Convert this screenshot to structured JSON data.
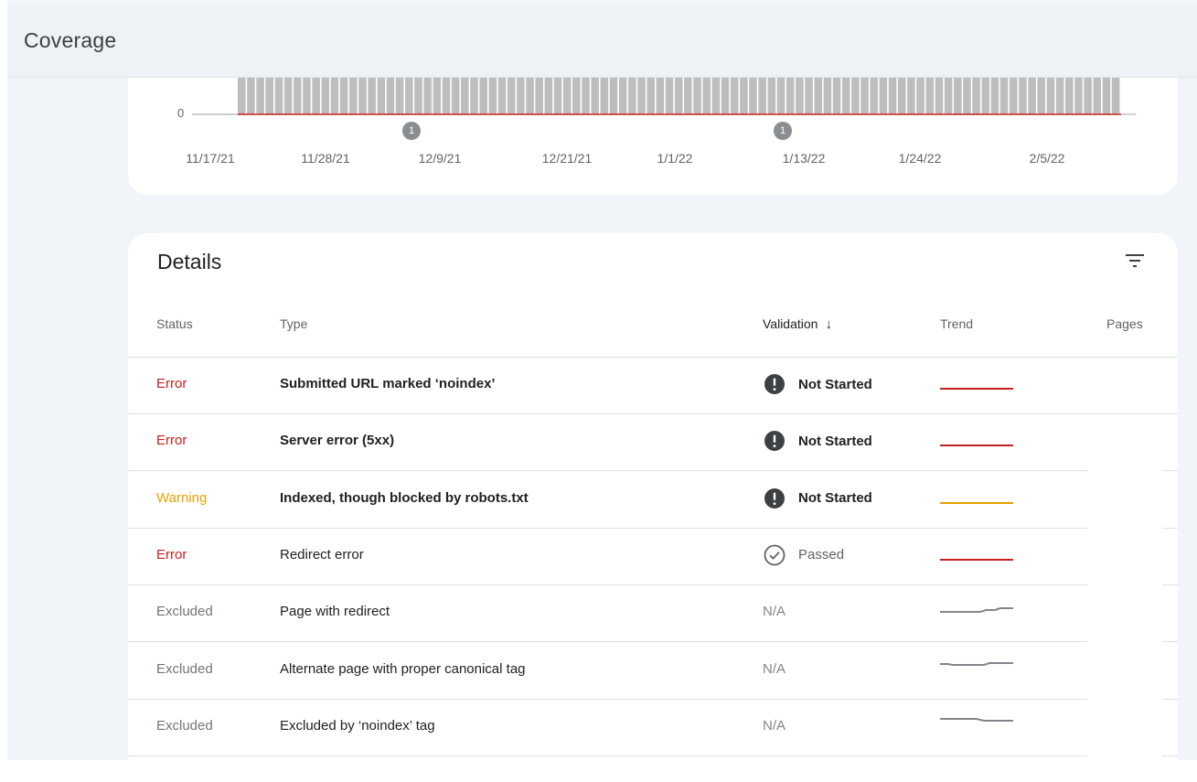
{
  "page": {
    "title": "Coverage"
  },
  "chart_data": {
    "type": "bar",
    "y_tick_labels": [
      "0"
    ],
    "x_tick_labels": [
      "11/17/21",
      "11/28/21",
      "12/9/21",
      "12/21/21",
      "1/1/22",
      "1/13/22",
      "1/24/22",
      "2/5/22"
    ],
    "bar_color": "#bdbdbd",
    "baseline_series_color": "#c5221f",
    "annotations": [
      {
        "label": "1",
        "near": "12/9/21"
      },
      {
        "label": "1",
        "near": "1/13/22"
      }
    ]
  },
  "details": {
    "title": "Details",
    "filter_icon": "filter-icon",
    "columns": {
      "status": "Status",
      "type": "Type",
      "validation": "Validation",
      "trend": "Trend",
      "pages": "Pages"
    },
    "rows": [
      {
        "status": "Error",
        "status_kind": "error",
        "type": "Submitted URL marked ‘noindex’",
        "type_bold": true,
        "validation": "Not Started",
        "validation_kind": "not-started",
        "trend_color": "#c5221f",
        "trend_shape": "flat"
      },
      {
        "status": "Error",
        "status_kind": "error",
        "type": "Server error (5xx)",
        "type_bold": true,
        "validation": "Not Started",
        "validation_kind": "not-started",
        "trend_color": "#c5221f",
        "trend_shape": "flat"
      },
      {
        "status": "Warning",
        "status_kind": "warning",
        "type": "Indexed, though blocked by robots.txt",
        "type_bold": true,
        "validation": "Not Started",
        "validation_kind": "not-started",
        "trend_color": "#e8a100",
        "trend_shape": "flat"
      },
      {
        "status": "Error",
        "status_kind": "error",
        "type": "Redirect error",
        "type_bold": false,
        "validation": "Passed",
        "validation_kind": "passed",
        "trend_color": "#c5221f",
        "trend_shape": "flat"
      },
      {
        "status": "Excluded",
        "status_kind": "excluded",
        "type": "Page with redirect",
        "type_bold": false,
        "validation": "N/A",
        "validation_kind": "na",
        "trend_color": "#80868b",
        "trend_shape": "step-up"
      },
      {
        "status": "Excluded",
        "status_kind": "excluded",
        "type": "Alternate page with proper canonical tag",
        "type_bold": false,
        "validation": "N/A",
        "validation_kind": "na",
        "trend_color": "#80868b",
        "trend_shape": "dip-up"
      },
      {
        "status": "Excluded",
        "status_kind": "excluded",
        "type": "Excluded by ‘noindex’ tag",
        "type_bold": false,
        "validation": "N/A",
        "validation_kind": "na",
        "trend_color": "#80868b",
        "trend_shape": "step-down"
      }
    ]
  }
}
